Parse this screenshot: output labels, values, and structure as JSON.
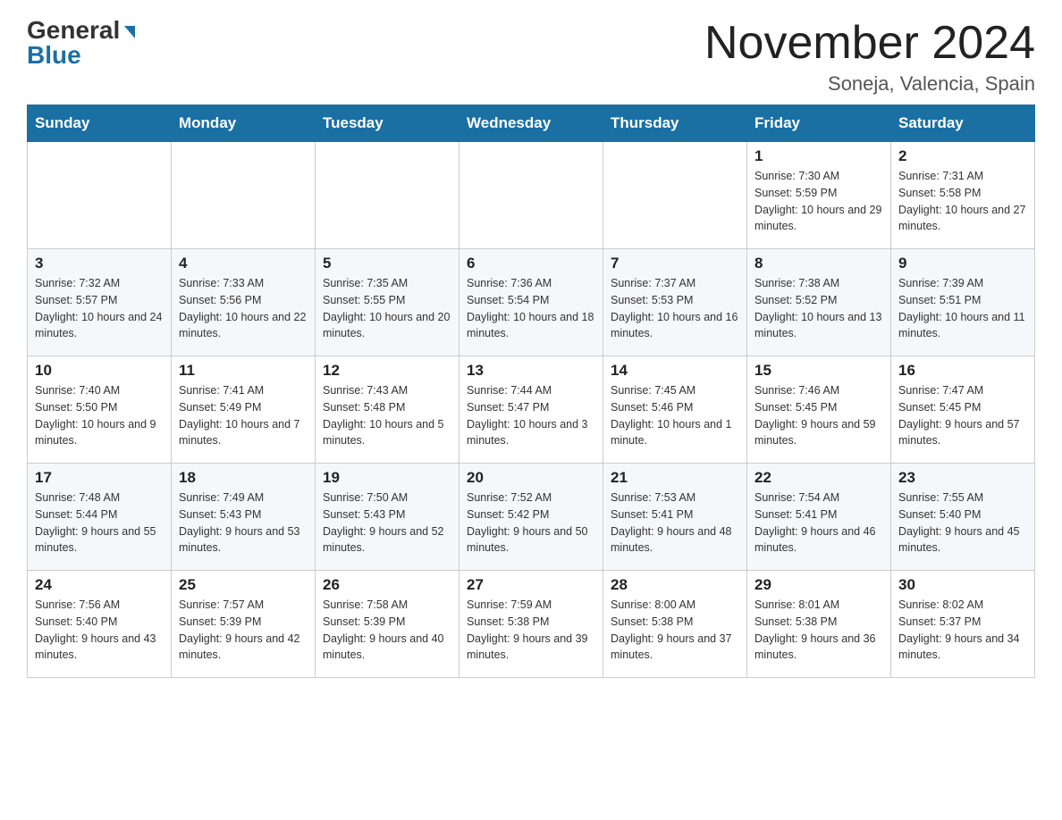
{
  "header": {
    "logo_general": "General",
    "logo_blue": "Blue",
    "month_title": "November 2024",
    "location": "Soneja, Valencia, Spain"
  },
  "weekdays": [
    "Sunday",
    "Monday",
    "Tuesday",
    "Wednesday",
    "Thursday",
    "Friday",
    "Saturday"
  ],
  "rows": [
    [
      {
        "day": "",
        "sunrise": "",
        "sunset": "",
        "daylight": ""
      },
      {
        "day": "",
        "sunrise": "",
        "sunset": "",
        "daylight": ""
      },
      {
        "day": "",
        "sunrise": "",
        "sunset": "",
        "daylight": ""
      },
      {
        "day": "",
        "sunrise": "",
        "sunset": "",
        "daylight": ""
      },
      {
        "day": "",
        "sunrise": "",
        "sunset": "",
        "daylight": ""
      },
      {
        "day": "1",
        "sunrise": "Sunrise: 7:30 AM",
        "sunset": "Sunset: 5:59 PM",
        "daylight": "Daylight: 10 hours and 29 minutes."
      },
      {
        "day": "2",
        "sunrise": "Sunrise: 7:31 AM",
        "sunset": "Sunset: 5:58 PM",
        "daylight": "Daylight: 10 hours and 27 minutes."
      }
    ],
    [
      {
        "day": "3",
        "sunrise": "Sunrise: 7:32 AM",
        "sunset": "Sunset: 5:57 PM",
        "daylight": "Daylight: 10 hours and 24 minutes."
      },
      {
        "day": "4",
        "sunrise": "Sunrise: 7:33 AM",
        "sunset": "Sunset: 5:56 PM",
        "daylight": "Daylight: 10 hours and 22 minutes."
      },
      {
        "day": "5",
        "sunrise": "Sunrise: 7:35 AM",
        "sunset": "Sunset: 5:55 PM",
        "daylight": "Daylight: 10 hours and 20 minutes."
      },
      {
        "day": "6",
        "sunrise": "Sunrise: 7:36 AM",
        "sunset": "Sunset: 5:54 PM",
        "daylight": "Daylight: 10 hours and 18 minutes."
      },
      {
        "day": "7",
        "sunrise": "Sunrise: 7:37 AM",
        "sunset": "Sunset: 5:53 PM",
        "daylight": "Daylight: 10 hours and 16 minutes."
      },
      {
        "day": "8",
        "sunrise": "Sunrise: 7:38 AM",
        "sunset": "Sunset: 5:52 PM",
        "daylight": "Daylight: 10 hours and 13 minutes."
      },
      {
        "day": "9",
        "sunrise": "Sunrise: 7:39 AM",
        "sunset": "Sunset: 5:51 PM",
        "daylight": "Daylight: 10 hours and 11 minutes."
      }
    ],
    [
      {
        "day": "10",
        "sunrise": "Sunrise: 7:40 AM",
        "sunset": "Sunset: 5:50 PM",
        "daylight": "Daylight: 10 hours and 9 minutes."
      },
      {
        "day": "11",
        "sunrise": "Sunrise: 7:41 AM",
        "sunset": "Sunset: 5:49 PM",
        "daylight": "Daylight: 10 hours and 7 minutes."
      },
      {
        "day": "12",
        "sunrise": "Sunrise: 7:43 AM",
        "sunset": "Sunset: 5:48 PM",
        "daylight": "Daylight: 10 hours and 5 minutes."
      },
      {
        "day": "13",
        "sunrise": "Sunrise: 7:44 AM",
        "sunset": "Sunset: 5:47 PM",
        "daylight": "Daylight: 10 hours and 3 minutes."
      },
      {
        "day": "14",
        "sunrise": "Sunrise: 7:45 AM",
        "sunset": "Sunset: 5:46 PM",
        "daylight": "Daylight: 10 hours and 1 minute."
      },
      {
        "day": "15",
        "sunrise": "Sunrise: 7:46 AM",
        "sunset": "Sunset: 5:45 PM",
        "daylight": "Daylight: 9 hours and 59 minutes."
      },
      {
        "day": "16",
        "sunrise": "Sunrise: 7:47 AM",
        "sunset": "Sunset: 5:45 PM",
        "daylight": "Daylight: 9 hours and 57 minutes."
      }
    ],
    [
      {
        "day": "17",
        "sunrise": "Sunrise: 7:48 AM",
        "sunset": "Sunset: 5:44 PM",
        "daylight": "Daylight: 9 hours and 55 minutes."
      },
      {
        "day": "18",
        "sunrise": "Sunrise: 7:49 AM",
        "sunset": "Sunset: 5:43 PM",
        "daylight": "Daylight: 9 hours and 53 minutes."
      },
      {
        "day": "19",
        "sunrise": "Sunrise: 7:50 AM",
        "sunset": "Sunset: 5:43 PM",
        "daylight": "Daylight: 9 hours and 52 minutes."
      },
      {
        "day": "20",
        "sunrise": "Sunrise: 7:52 AM",
        "sunset": "Sunset: 5:42 PM",
        "daylight": "Daylight: 9 hours and 50 minutes."
      },
      {
        "day": "21",
        "sunrise": "Sunrise: 7:53 AM",
        "sunset": "Sunset: 5:41 PM",
        "daylight": "Daylight: 9 hours and 48 minutes."
      },
      {
        "day": "22",
        "sunrise": "Sunrise: 7:54 AM",
        "sunset": "Sunset: 5:41 PM",
        "daylight": "Daylight: 9 hours and 46 minutes."
      },
      {
        "day": "23",
        "sunrise": "Sunrise: 7:55 AM",
        "sunset": "Sunset: 5:40 PM",
        "daylight": "Daylight: 9 hours and 45 minutes."
      }
    ],
    [
      {
        "day": "24",
        "sunrise": "Sunrise: 7:56 AM",
        "sunset": "Sunset: 5:40 PM",
        "daylight": "Daylight: 9 hours and 43 minutes."
      },
      {
        "day": "25",
        "sunrise": "Sunrise: 7:57 AM",
        "sunset": "Sunset: 5:39 PM",
        "daylight": "Daylight: 9 hours and 42 minutes."
      },
      {
        "day": "26",
        "sunrise": "Sunrise: 7:58 AM",
        "sunset": "Sunset: 5:39 PM",
        "daylight": "Daylight: 9 hours and 40 minutes."
      },
      {
        "day": "27",
        "sunrise": "Sunrise: 7:59 AM",
        "sunset": "Sunset: 5:38 PM",
        "daylight": "Daylight: 9 hours and 39 minutes."
      },
      {
        "day": "28",
        "sunrise": "Sunrise: 8:00 AM",
        "sunset": "Sunset: 5:38 PM",
        "daylight": "Daylight: 9 hours and 37 minutes."
      },
      {
        "day": "29",
        "sunrise": "Sunrise: 8:01 AM",
        "sunset": "Sunset: 5:38 PM",
        "daylight": "Daylight: 9 hours and 36 minutes."
      },
      {
        "day": "30",
        "sunrise": "Sunrise: 8:02 AM",
        "sunset": "Sunset: 5:37 PM",
        "daylight": "Daylight: 9 hours and 34 minutes."
      }
    ]
  ]
}
